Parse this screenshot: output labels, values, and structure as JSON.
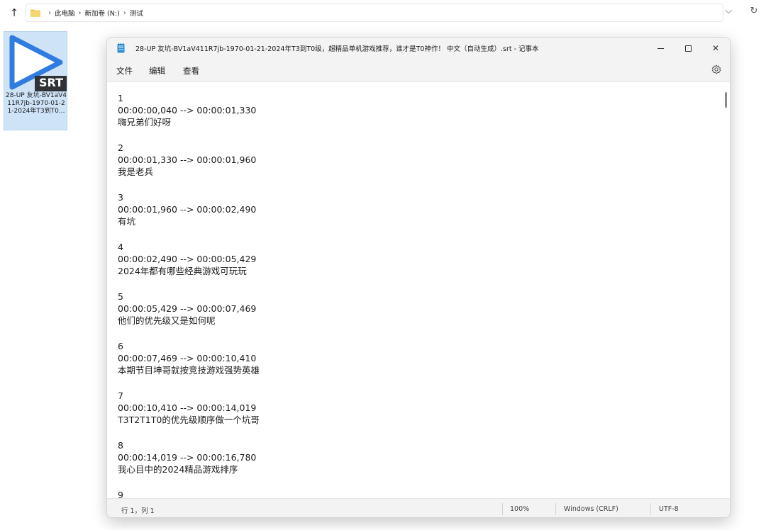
{
  "explorer": {
    "breadcrumb": [
      "此电脑",
      "新加卷 (N:)",
      "测试"
    ],
    "separator": "›"
  },
  "desktop_file": {
    "badge": "SRT",
    "name": "28-UP 友坑-BV1aV411R7jb-1970-01-21-2024年T3到T0..."
  },
  "notepad": {
    "title": "28-UP 友坑-BV1aV411R7jb-1970-01-21-2024年T3到T0级，超精品单机游戏推荐，谁才是T0神作！ 中文（自动生成）.srt - 记事本",
    "menu": [
      "文件",
      "编辑",
      "查看"
    ],
    "entries": [
      {
        "index": "1",
        "time": "00:00:00,040 --> 00:00:01,330",
        "text": "嗨兄弟们好呀"
      },
      {
        "index": "2",
        "time": "00:00:01,330 --> 00:00:01,960",
        "text": "我是老兵"
      },
      {
        "index": "3",
        "time": "00:00:01,960 --> 00:00:02,490",
        "text": "有坑"
      },
      {
        "index": "4",
        "time": "00:00:02,490 --> 00:00:05,429",
        "text": "2024年都有哪些经典游戏可玩玩"
      },
      {
        "index": "5",
        "time": "00:00:05,429 --> 00:00:07,469",
        "text": "他们的优先级又是如何呢"
      },
      {
        "index": "6",
        "time": "00:00:07,469 --> 00:00:10,410",
        "text": "本期节目坤哥就按竞技游戏强势英雄"
      },
      {
        "index": "7",
        "time": "00:00:10,410 --> 00:00:14,019",
        "text": "T3T2T1T0的优先级顺序做一个坑哥"
      },
      {
        "index": "8",
        "time": "00:00:14,019 --> 00:00:16,780",
        "text": "我心目中的2024精品游戏排序"
      },
      {
        "index": "9",
        "time": "",
        "text": ""
      }
    ],
    "status": {
      "position": "行 1，列 1",
      "zoom": "100%",
      "line_ending": "Windows (CRLF)",
      "encoding": "UTF-8"
    }
  }
}
